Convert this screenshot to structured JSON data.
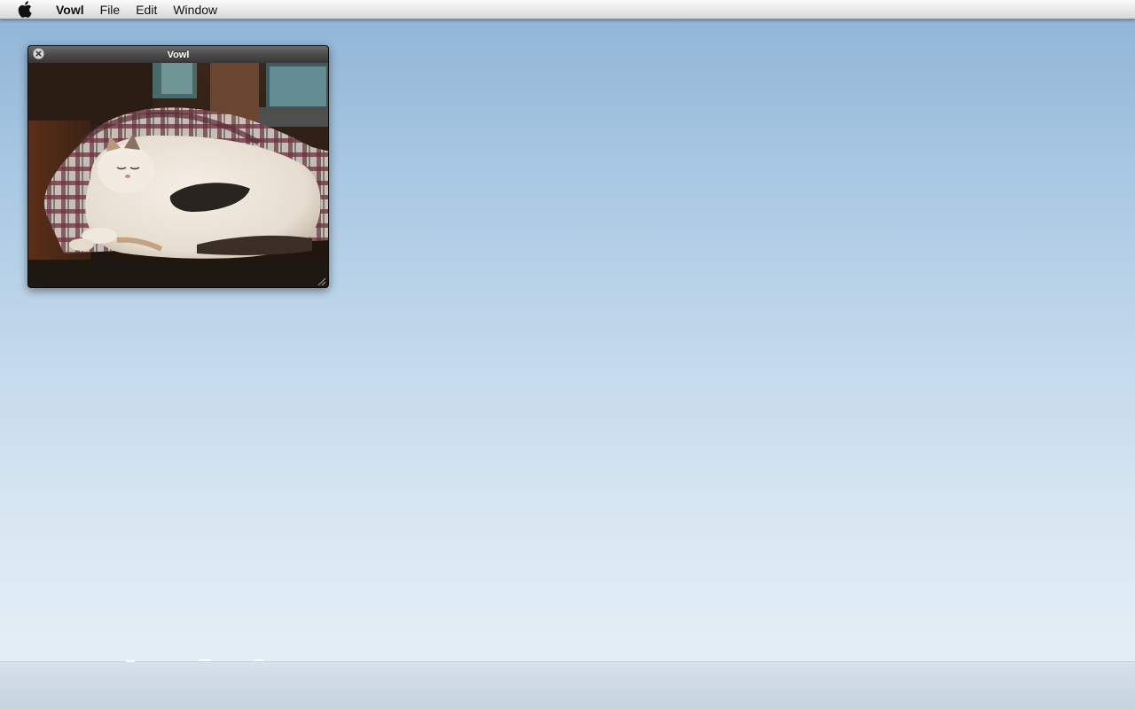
{
  "menubar": {
    "apple_icon": "apple-logo-icon",
    "items": [
      {
        "label": "Vowl",
        "bold": true
      },
      {
        "label": "File"
      },
      {
        "label": "Edit"
      },
      {
        "label": "Window"
      }
    ]
  },
  "window": {
    "title": "Vowl",
    "close_icon": "close-icon",
    "resize_icon": "resize-grip-icon",
    "content": "sleeping-cat-photo"
  },
  "desktop": {
    "wallpaper": "sky-and-sea"
  },
  "colors": {
    "menubar_bg": "#e8e8e8",
    "hud_title_bg": "#4b4b4b",
    "sky_top": "#8fb4d6",
    "sky_bottom": "#e4eef6"
  }
}
